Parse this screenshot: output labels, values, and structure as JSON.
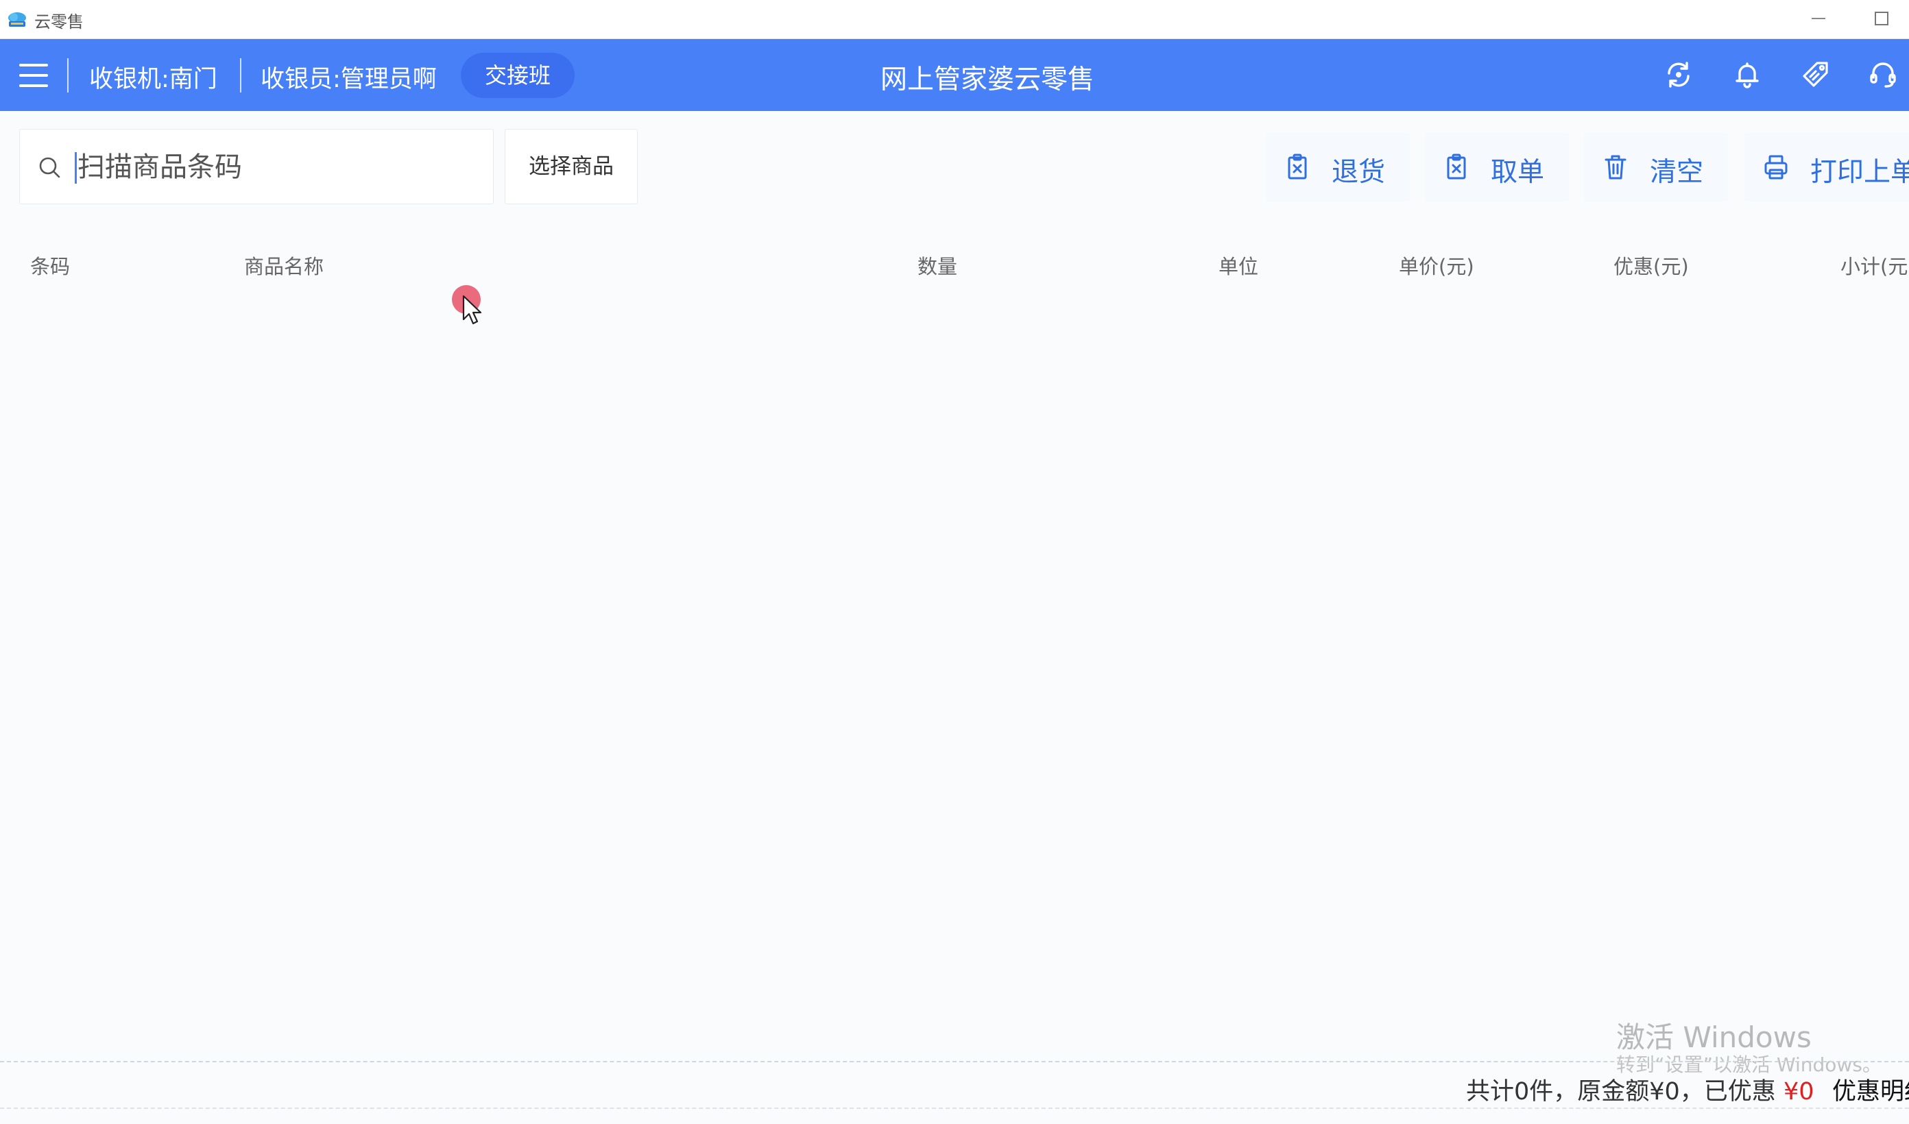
{
  "window": {
    "title": "云零售"
  },
  "header": {
    "cashier_machine": "收银机:南门",
    "cashier": "收银员:管理员啊",
    "shift_button": "交接班",
    "app_title": "网上管家婆云零售"
  },
  "toolbar": {
    "search_placeholder": "扫描商品条码",
    "select_product": "选择商品",
    "actions": [
      {
        "label": "退货",
        "icon": "clipboard-x-icon"
      },
      {
        "label": "取单",
        "icon": "clipboard-x-icon"
      },
      {
        "label": "清空",
        "icon": "trash-icon"
      },
      {
        "label": "打印上单",
        "icon": "printer-icon"
      }
    ]
  },
  "table": {
    "columns": [
      "条码",
      "商品名称",
      "数量",
      "单位",
      "单价(元)",
      "优惠(元)",
      "小计(元)"
    ],
    "rows": []
  },
  "footer": {
    "summary_prefix": "共计0件，原金额¥0，已优惠",
    "discount_value": "¥0",
    "discount_detail": "优惠明细"
  },
  "watermark": {
    "title": "激活 Windows",
    "subtitle": "转到“设置”以激活 Windows。"
  },
  "colors": {
    "header_bg": "#4880f8",
    "accent": "#2f6fe0",
    "discount": "#e02020"
  }
}
